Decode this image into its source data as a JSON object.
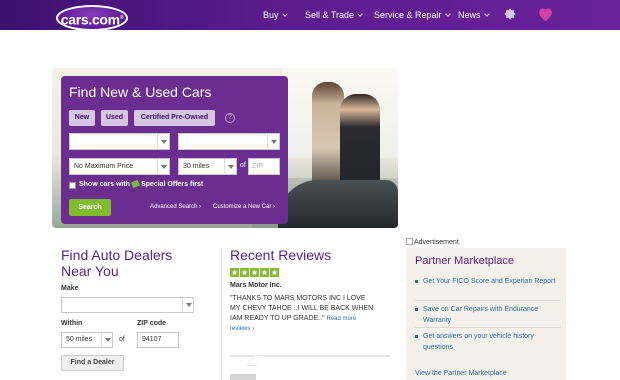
{
  "header": {
    "logo_text": "cars.com",
    "logo_mark": "®",
    "nav": [
      {
        "label": "Buy"
      },
      {
        "label": "Sell & Trade"
      },
      {
        "label": "Service & Repair"
      },
      {
        "label": "News"
      }
    ],
    "icons": {
      "settings": "gear-icon",
      "saved": "heart-icon"
    },
    "colors": {
      "bar": "#5b1c8e",
      "heart": "#d33fa8"
    }
  },
  "finder": {
    "title": "Find New & Used Cars",
    "tabs": [
      "New",
      "Used",
      "Certified Pre-Owned"
    ],
    "help": "?",
    "make_value": "",
    "model_value": "",
    "price_value": "No Maximum Price",
    "distance_value": "30 miles",
    "of_label": "of",
    "zip_placeholder": "ZIP",
    "checkbox_prefix": "Show cars with",
    "checkbox_suffix": "Special Offers first",
    "search_label": "Search",
    "advanced_link": "Advanced Search ›",
    "customize_link": "Customize a New Car ›",
    "colors": {
      "panel": "#6b2d8f",
      "search": "#7fbd2e"
    }
  },
  "dealers": {
    "title_line1": "Find Auto Dealers",
    "title_line2": "Near You",
    "make_label": "Make",
    "make_value": "",
    "within_label": "Within",
    "within_value": "50 miles",
    "of_label": "of",
    "zip_label": "ZIP code",
    "zip_value": "94107",
    "button_label": "Find a Dealer"
  },
  "reviews": {
    "title": "Recent Reviews",
    "rating": 5,
    "dealer_name": "Mars Motor Inc.",
    "quote": "\"THANKS TO MARS MOTORS INC I LOVE MY CHEVY TAHOE ..I WILL BE BACK WHEN IAM READY TO UP GRADE..\"",
    "read_more": "Read more reviews ›"
  },
  "partner": {
    "ad_alt": "Advertisement",
    "title": "Partner Marketplace",
    "items": [
      "Get Your FICO Score and Experian Report",
      "Save on Car Repairs with Endurance Warranty",
      "Get answers on your vehicle history questions"
    ],
    "view_link": "View the Partner Marketplace"
  }
}
